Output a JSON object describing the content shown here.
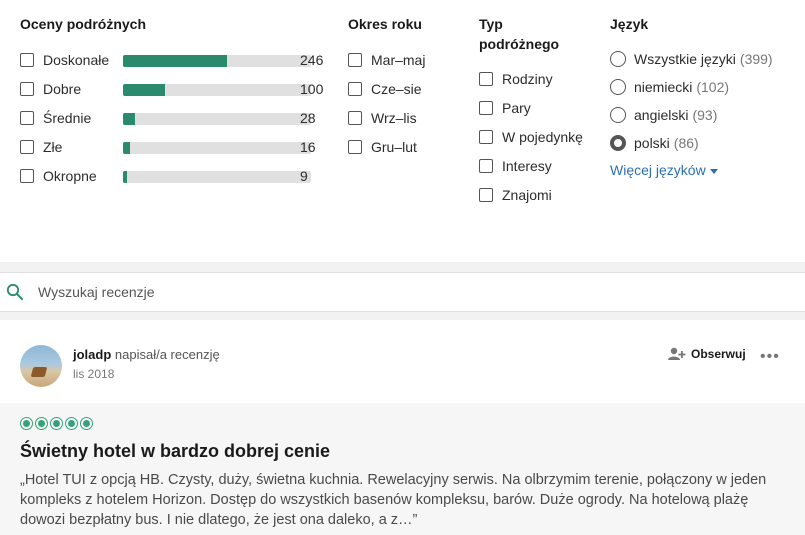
{
  "filters": {
    "ratings": {
      "title": "Oceny podróżnych",
      "items": [
        {
          "label": "Doskonałe",
          "count": "246",
          "fraction": 0.553
        },
        {
          "label": "Dobre",
          "count": "100",
          "fraction": 0.224
        },
        {
          "label": "Średnie",
          "count": "28",
          "fraction": 0.063
        },
        {
          "label": "Złe",
          "count": "16",
          "fraction": 0.036
        },
        {
          "label": "Okropne",
          "count": "9",
          "fraction": 0.02
        }
      ]
    },
    "season": {
      "title": "Okres roku",
      "items": [
        "Mar–maj",
        "Cze–sie",
        "Wrz–lis",
        "Gru–lut"
      ]
    },
    "traveler_type": {
      "title_line1": "Typ",
      "title_line2": "podróżnego",
      "items": [
        "Rodziny",
        "Pary",
        "W pojedynkę",
        "Interesy",
        "Znajomi"
      ]
    },
    "language": {
      "title": "Język",
      "items": [
        {
          "label": "Wszystkie języki",
          "count": "(399)",
          "selected": false
        },
        {
          "label": "niemiecki",
          "count": "(102)",
          "selected": false
        },
        {
          "label": "angielski",
          "count": "(93)",
          "selected": false
        },
        {
          "label": "polski",
          "count": "(86)",
          "selected": true
        }
      ],
      "more_label": "Więcej języków"
    }
  },
  "search": {
    "placeholder": "Wyszukaj recenzje",
    "icon": "search-icon"
  },
  "review": {
    "username": "joladp",
    "action": "napisał/a recenzję",
    "date": "lis 2018",
    "follow_label": "Obserwuj",
    "more_icon": "more-icon",
    "rating_bubbles": 5,
    "title": "Świetny hotel w bardzo dobrej cenie",
    "text": "„Hotel TUI z opcją HB. Czysty, duży, świetna kuchnia. Rewelacyjny serwis. Na olbrzymim terenie, połączony w jeden kompleks z hotelem Horizon. Dostęp do wszystkich basenów kompleksu, barów. Duże ogrody. Na hotelową plażę dowozi bezpłatny bus. I nie dlatego, że jest ona daleko, a z…”"
  },
  "colors": {
    "bar": "#2b8a6e",
    "bubble": "#34a27a",
    "link": "#2a6fb1"
  }
}
